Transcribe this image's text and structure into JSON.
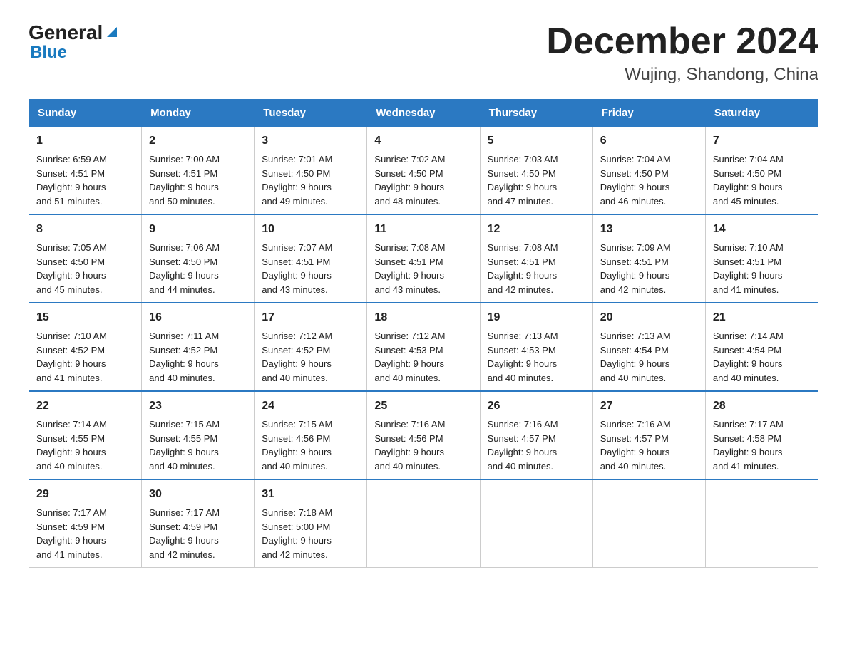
{
  "logo": {
    "part1": "General",
    "part2": "Blue"
  },
  "title": "December 2024",
  "subtitle": "Wujing, Shandong, China",
  "days": [
    "Sunday",
    "Monday",
    "Tuesday",
    "Wednesday",
    "Thursday",
    "Friday",
    "Saturday"
  ],
  "weeks": [
    [
      {
        "day": 1,
        "sunrise": "Sunrise: 6:59 AM",
        "sunset": "Sunset: 4:51 PM",
        "daylight": "Daylight: 9 hours",
        "daylight2": "and 51 minutes."
      },
      {
        "day": 2,
        "sunrise": "Sunrise: 7:00 AM",
        "sunset": "Sunset: 4:51 PM",
        "daylight": "Daylight: 9 hours",
        "daylight2": "and 50 minutes."
      },
      {
        "day": 3,
        "sunrise": "Sunrise: 7:01 AM",
        "sunset": "Sunset: 4:50 PM",
        "daylight": "Daylight: 9 hours",
        "daylight2": "and 49 minutes."
      },
      {
        "day": 4,
        "sunrise": "Sunrise: 7:02 AM",
        "sunset": "Sunset: 4:50 PM",
        "daylight": "Daylight: 9 hours",
        "daylight2": "and 48 minutes."
      },
      {
        "day": 5,
        "sunrise": "Sunrise: 7:03 AM",
        "sunset": "Sunset: 4:50 PM",
        "daylight": "Daylight: 9 hours",
        "daylight2": "and 47 minutes."
      },
      {
        "day": 6,
        "sunrise": "Sunrise: 7:04 AM",
        "sunset": "Sunset: 4:50 PM",
        "daylight": "Daylight: 9 hours",
        "daylight2": "and 46 minutes."
      },
      {
        "day": 7,
        "sunrise": "Sunrise: 7:04 AM",
        "sunset": "Sunset: 4:50 PM",
        "daylight": "Daylight: 9 hours",
        "daylight2": "and 45 minutes."
      }
    ],
    [
      {
        "day": 8,
        "sunrise": "Sunrise: 7:05 AM",
        "sunset": "Sunset: 4:50 PM",
        "daylight": "Daylight: 9 hours",
        "daylight2": "and 45 minutes."
      },
      {
        "day": 9,
        "sunrise": "Sunrise: 7:06 AM",
        "sunset": "Sunset: 4:50 PM",
        "daylight": "Daylight: 9 hours",
        "daylight2": "and 44 minutes."
      },
      {
        "day": 10,
        "sunrise": "Sunrise: 7:07 AM",
        "sunset": "Sunset: 4:51 PM",
        "daylight": "Daylight: 9 hours",
        "daylight2": "and 43 minutes."
      },
      {
        "day": 11,
        "sunrise": "Sunrise: 7:08 AM",
        "sunset": "Sunset: 4:51 PM",
        "daylight": "Daylight: 9 hours",
        "daylight2": "and 43 minutes."
      },
      {
        "day": 12,
        "sunrise": "Sunrise: 7:08 AM",
        "sunset": "Sunset: 4:51 PM",
        "daylight": "Daylight: 9 hours",
        "daylight2": "and 42 minutes."
      },
      {
        "day": 13,
        "sunrise": "Sunrise: 7:09 AM",
        "sunset": "Sunset: 4:51 PM",
        "daylight": "Daylight: 9 hours",
        "daylight2": "and 42 minutes."
      },
      {
        "day": 14,
        "sunrise": "Sunrise: 7:10 AM",
        "sunset": "Sunset: 4:51 PM",
        "daylight": "Daylight: 9 hours",
        "daylight2": "and 41 minutes."
      }
    ],
    [
      {
        "day": 15,
        "sunrise": "Sunrise: 7:10 AM",
        "sunset": "Sunset: 4:52 PM",
        "daylight": "Daylight: 9 hours",
        "daylight2": "and 41 minutes."
      },
      {
        "day": 16,
        "sunrise": "Sunrise: 7:11 AM",
        "sunset": "Sunset: 4:52 PM",
        "daylight": "Daylight: 9 hours",
        "daylight2": "and 40 minutes."
      },
      {
        "day": 17,
        "sunrise": "Sunrise: 7:12 AM",
        "sunset": "Sunset: 4:52 PM",
        "daylight": "Daylight: 9 hours",
        "daylight2": "and 40 minutes."
      },
      {
        "day": 18,
        "sunrise": "Sunrise: 7:12 AM",
        "sunset": "Sunset: 4:53 PM",
        "daylight": "Daylight: 9 hours",
        "daylight2": "and 40 minutes."
      },
      {
        "day": 19,
        "sunrise": "Sunrise: 7:13 AM",
        "sunset": "Sunset: 4:53 PM",
        "daylight": "Daylight: 9 hours",
        "daylight2": "and 40 minutes."
      },
      {
        "day": 20,
        "sunrise": "Sunrise: 7:13 AM",
        "sunset": "Sunset: 4:54 PM",
        "daylight": "Daylight: 9 hours",
        "daylight2": "and 40 minutes."
      },
      {
        "day": 21,
        "sunrise": "Sunrise: 7:14 AM",
        "sunset": "Sunset: 4:54 PM",
        "daylight": "Daylight: 9 hours",
        "daylight2": "and 40 minutes."
      }
    ],
    [
      {
        "day": 22,
        "sunrise": "Sunrise: 7:14 AM",
        "sunset": "Sunset: 4:55 PM",
        "daylight": "Daylight: 9 hours",
        "daylight2": "and 40 minutes."
      },
      {
        "day": 23,
        "sunrise": "Sunrise: 7:15 AM",
        "sunset": "Sunset: 4:55 PM",
        "daylight": "Daylight: 9 hours",
        "daylight2": "and 40 minutes."
      },
      {
        "day": 24,
        "sunrise": "Sunrise: 7:15 AM",
        "sunset": "Sunset: 4:56 PM",
        "daylight": "Daylight: 9 hours",
        "daylight2": "and 40 minutes."
      },
      {
        "day": 25,
        "sunrise": "Sunrise: 7:16 AM",
        "sunset": "Sunset: 4:56 PM",
        "daylight": "Daylight: 9 hours",
        "daylight2": "and 40 minutes."
      },
      {
        "day": 26,
        "sunrise": "Sunrise: 7:16 AM",
        "sunset": "Sunset: 4:57 PM",
        "daylight": "Daylight: 9 hours",
        "daylight2": "and 40 minutes."
      },
      {
        "day": 27,
        "sunrise": "Sunrise: 7:16 AM",
        "sunset": "Sunset: 4:57 PM",
        "daylight": "Daylight: 9 hours",
        "daylight2": "and 40 minutes."
      },
      {
        "day": 28,
        "sunrise": "Sunrise: 7:17 AM",
        "sunset": "Sunset: 4:58 PM",
        "daylight": "Daylight: 9 hours",
        "daylight2": "and 41 minutes."
      }
    ],
    [
      {
        "day": 29,
        "sunrise": "Sunrise: 7:17 AM",
        "sunset": "Sunset: 4:59 PM",
        "daylight": "Daylight: 9 hours",
        "daylight2": "and 41 minutes."
      },
      {
        "day": 30,
        "sunrise": "Sunrise: 7:17 AM",
        "sunset": "Sunset: 4:59 PM",
        "daylight": "Daylight: 9 hours",
        "daylight2": "and 42 minutes."
      },
      {
        "day": 31,
        "sunrise": "Sunrise: 7:18 AM",
        "sunset": "Sunset: 5:00 PM",
        "daylight": "Daylight: 9 hours",
        "daylight2": "and 42 minutes."
      },
      null,
      null,
      null,
      null
    ]
  ]
}
